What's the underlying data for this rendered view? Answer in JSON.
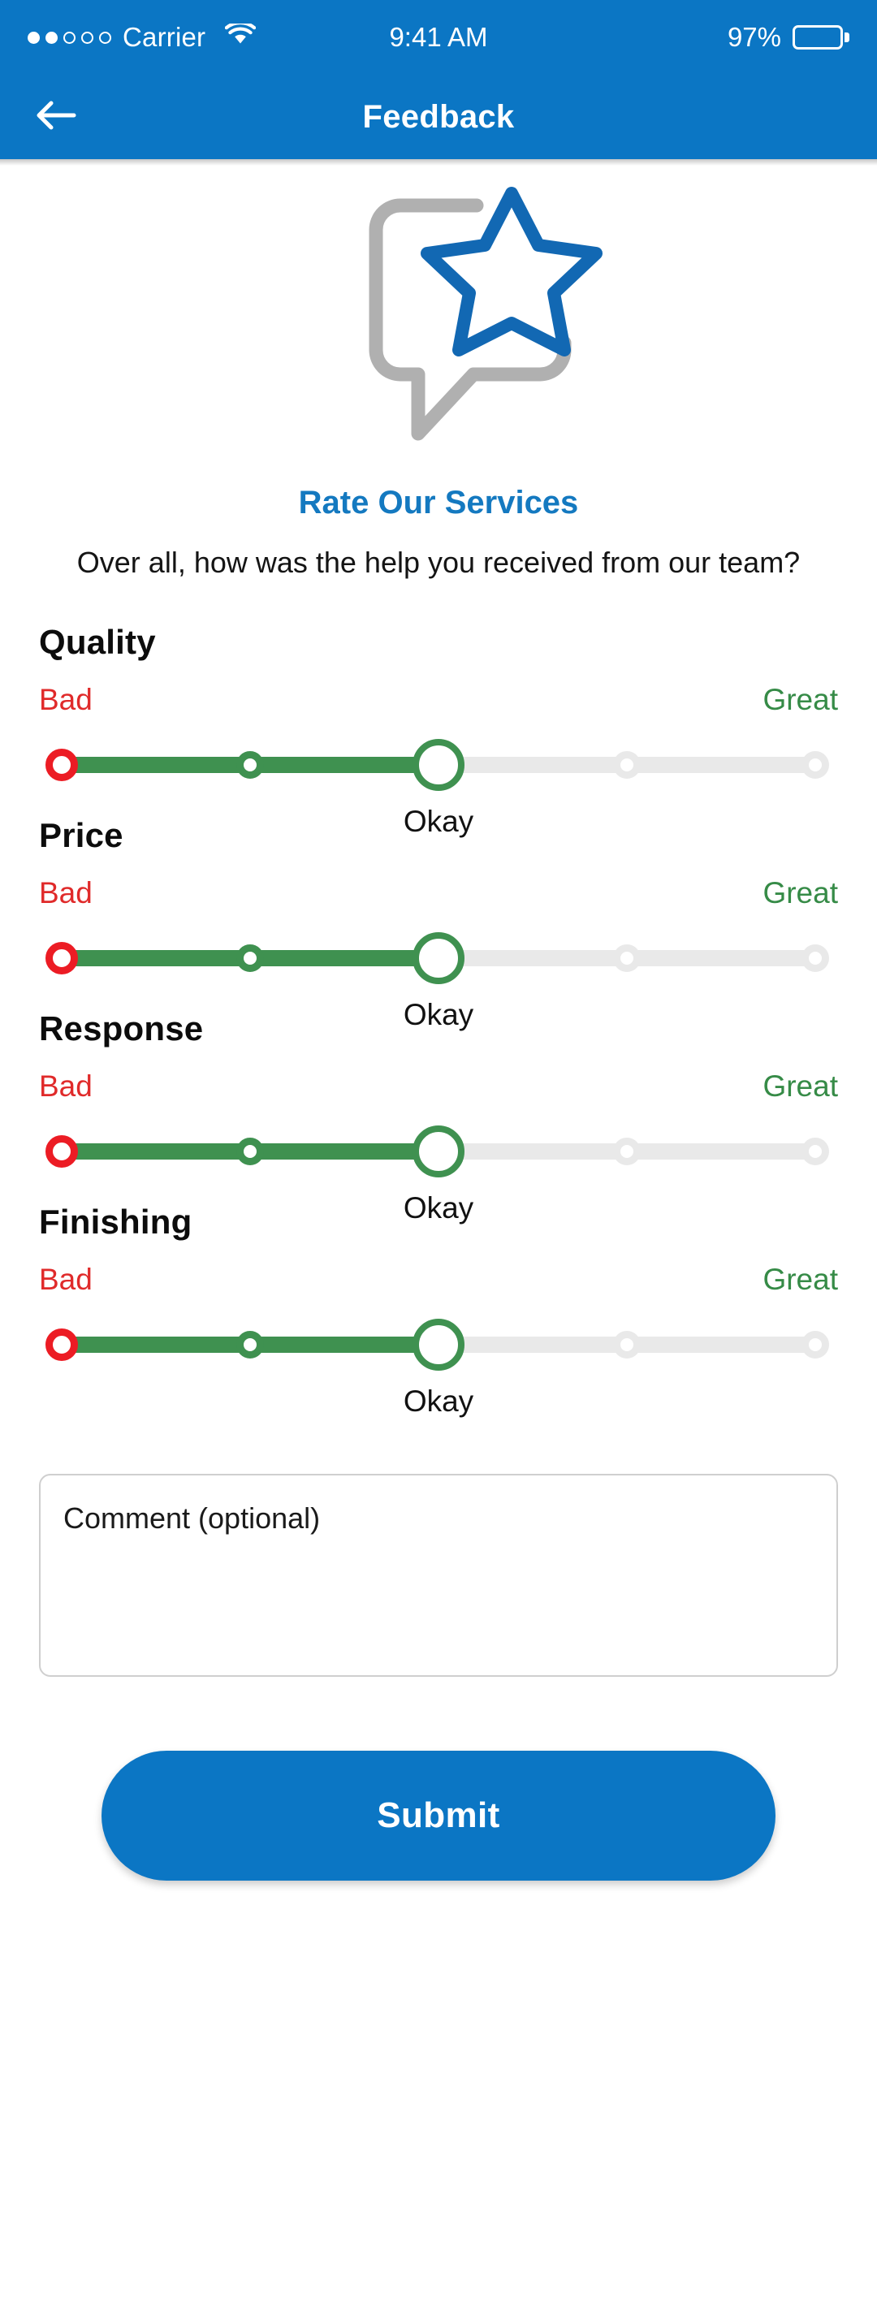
{
  "status_bar": {
    "carrier": "Carrier",
    "signal_dots_total": 5,
    "signal_dots_filled": 2,
    "wifi_icon": "wifi-icon",
    "time": "9:41 AM",
    "battery_percent": "97%",
    "battery_level": 97
  },
  "nav": {
    "back_icon": "back-arrow-icon",
    "title": "Feedback"
  },
  "hero": {
    "illustration": "speech-bubble-with-star-icon",
    "bubble_color": "#b0b0b0",
    "star_color": "#1268b3"
  },
  "intro": {
    "headline": "Rate Our Services",
    "headline_color": "#1479c0",
    "subhead": "Over all, how was the help you received from our team?"
  },
  "slider_scale": {
    "min_label": "Bad",
    "max_label": "Great",
    "min_color": "#e02a2a",
    "max_color": "#368b47",
    "steps": 5,
    "active_color": "#3f9150",
    "inactive_color": "#e9e9e9",
    "start_tick_color": "#ec1c24"
  },
  "ratings": [
    {
      "title": "Quality",
      "value": 2,
      "value_label": "Okay"
    },
    {
      "title": "Price",
      "value": 2,
      "value_label": "Okay"
    },
    {
      "title": "Response",
      "value": 2,
      "value_label": "Okay"
    },
    {
      "title": "Finishing",
      "value": 2,
      "value_label": "Okay"
    }
  ],
  "comment": {
    "placeholder": "Comment (optional)",
    "value": ""
  },
  "submit": {
    "label": "Submit",
    "color": "#0b76c4"
  }
}
